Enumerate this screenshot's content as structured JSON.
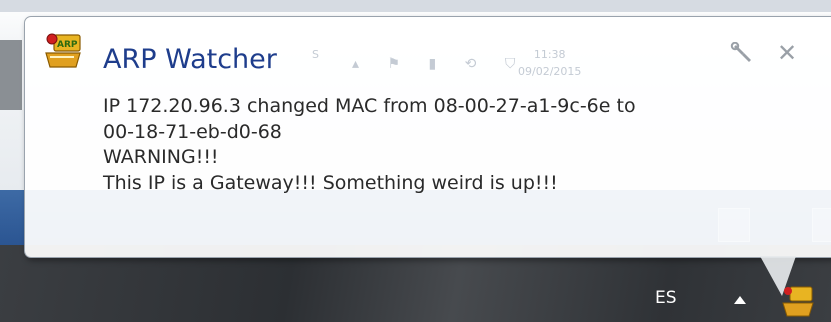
{
  "notification": {
    "title": "ARP Watcher",
    "message_lines": [
      "IP 172.20.96.3 changed MAC from 08-00-27-a1-9c-6e to",
      "00-18-71-eb-d0-68",
      "WARNING!!!",
      "This IP is a Gateway!!! Something weird is up!!!"
    ],
    "icons": {
      "app": "arp-watcher-app-icon",
      "options": "wrench-icon",
      "close": "close-icon"
    }
  },
  "background_tray": {
    "superscript": "S",
    "clock_time": "11:38",
    "clock_date": "09/02/2015"
  },
  "taskbar": {
    "language": "ES",
    "icons": [
      "chevron-up-icon",
      "arp-watcher-tray-icon"
    ]
  },
  "colors": {
    "title": "#1e3d8c",
    "balloon_bg": "#ffffff",
    "taskbar": "#2f3236",
    "band": "#2b5592"
  }
}
